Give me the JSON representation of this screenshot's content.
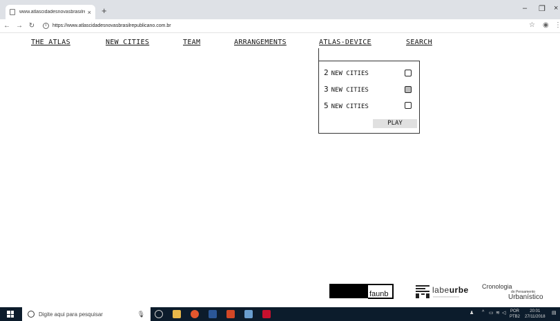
{
  "browser": {
    "tab_title": "www.atlascidadesnovasbrasilrep…",
    "tab_close": "×",
    "new_tab": "+",
    "url_host": "https://www.atlascidadesnovasbrasilrepublicano.com.br",
    "win_minimize": "–",
    "win_maximize": "❐",
    "win_close": "×"
  },
  "menu": {
    "items": [
      "THE ATLAS",
      "NEW CITIES",
      "TEAM",
      "ARRANGEMENTS",
      "ATLAS-DEVICE",
      "SEARCH"
    ]
  },
  "device": {
    "options": [
      {
        "num": "2",
        "label": "NEW CITIES",
        "checked": false
      },
      {
        "num": "3",
        "label": "NEW CITIES",
        "checked": true
      },
      {
        "num": "5",
        "label": "NEW CITIES",
        "checked": false
      }
    ],
    "play_label": "PLAY"
  },
  "footer": {
    "faunb": "faunb",
    "labeurbe_prefix": "labe",
    "labeurbe_bold": "urbe",
    "crono_1": "Cronologia",
    "crono_2": "do Pensamento",
    "crono_3": "Urbanístico"
  },
  "taskbar": {
    "search_placeholder": "Digite aqui para pesquisar",
    "lang_1": "POR",
    "lang_2": "PTB2",
    "time": "20:01",
    "date": "27/11/2018"
  }
}
